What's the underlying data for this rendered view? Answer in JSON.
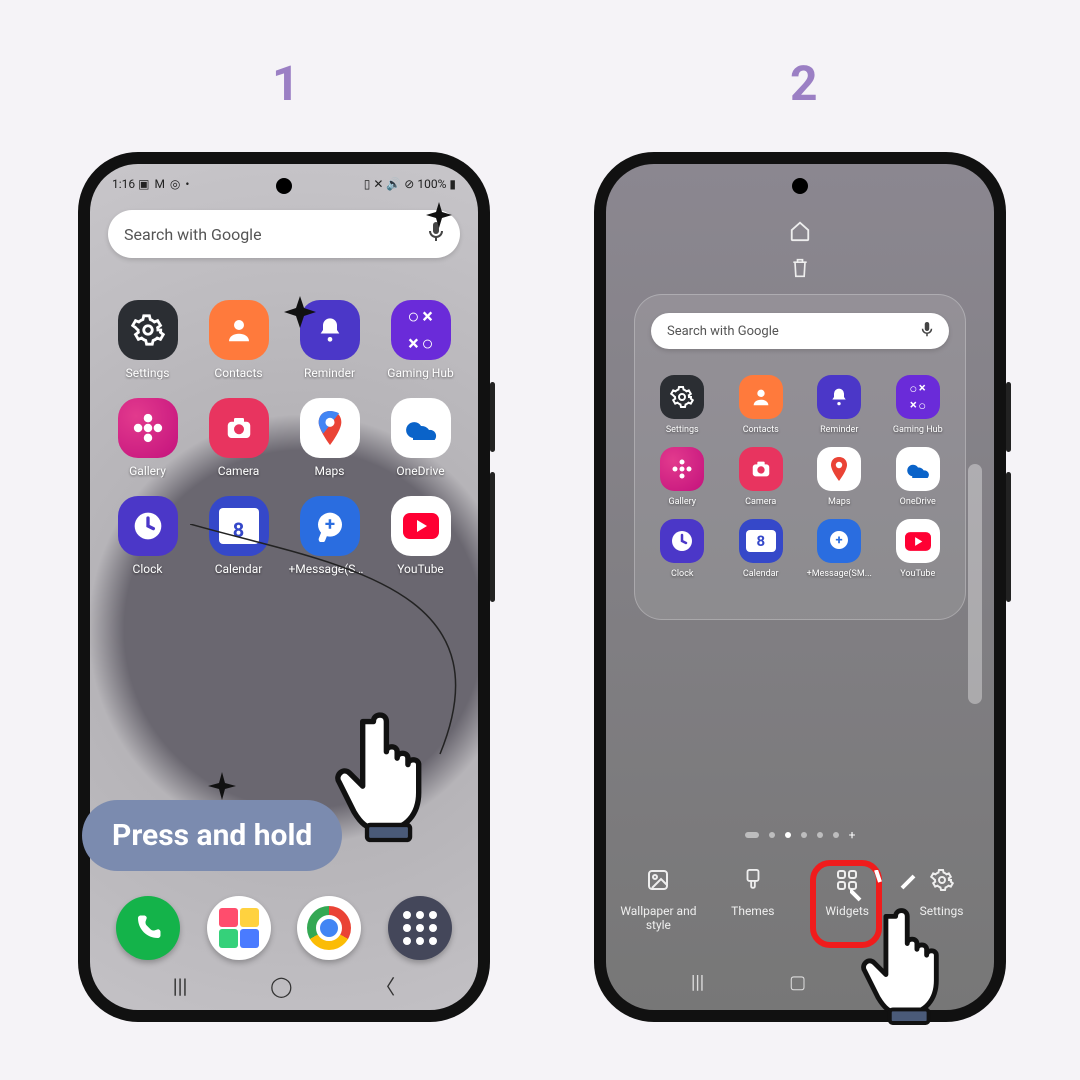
{
  "steps": {
    "one": "1",
    "two": "2"
  },
  "status": {
    "time": "1:16",
    "battery": "100%"
  },
  "search": {
    "placeholder": "Search with Google"
  },
  "apps": {
    "settings": {
      "label": "Settings"
    },
    "contacts": {
      "label": "Contacts"
    },
    "reminder": {
      "label": "Reminder"
    },
    "gaming": {
      "label": "Gaming Hub"
    },
    "gallery": {
      "label": "Gallery"
    },
    "camera": {
      "label": "Camera"
    },
    "maps": {
      "label": "Maps"
    },
    "onedrive": {
      "label": "OneDrive"
    },
    "clock": {
      "label": "Clock"
    },
    "calendar": {
      "label": "Calendar",
      "day": "8"
    },
    "message": {
      "label": "+Message(SM..."
    },
    "youtube": {
      "label": "YouTube"
    }
  },
  "callout": {
    "text": "Press and hold"
  },
  "edit_actions": {
    "wallpaper": {
      "label": "Wallpaper and style"
    },
    "themes": {
      "label": "Themes"
    },
    "widgets": {
      "label": "Widgets"
    },
    "settings": {
      "label": "Settings"
    }
  }
}
